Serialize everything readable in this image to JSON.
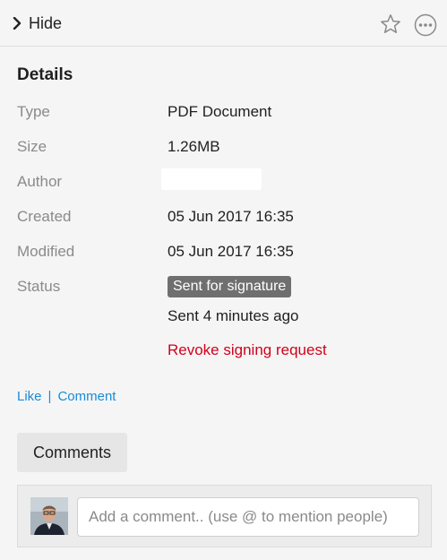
{
  "header": {
    "toggle_label": "Hide",
    "toggle_icon": "chevron-right-icon",
    "favorite_icon": "star-outline-icon",
    "more_icon": "ellipsis-circle-icon"
  },
  "details": {
    "title": "Details",
    "type_label": "Type",
    "type_value": "PDF Document",
    "size_label": "Size",
    "size_value": "1.26MB",
    "author_label": "Author",
    "author_value": "",
    "created_label": "Created",
    "created_value": "05 Jun 2017 16:35",
    "modified_label": "Modified",
    "modified_value": "05 Jun 2017 16:35",
    "status_label": "Status",
    "status_badge": "Sent for signature",
    "status_time": "Sent 4 minutes ago",
    "revoke_label": "Revoke signing request"
  },
  "social": {
    "like_label": "Like",
    "separator": "|",
    "comment_label": "Comment"
  },
  "comments": {
    "tab_label": "Comments",
    "input_placeholder": "Add a comment.. (use @ to mention people)"
  },
  "colors": {
    "link": "#1a8bd6",
    "danger": "#d0021b",
    "badge": "#6f6f6f"
  }
}
